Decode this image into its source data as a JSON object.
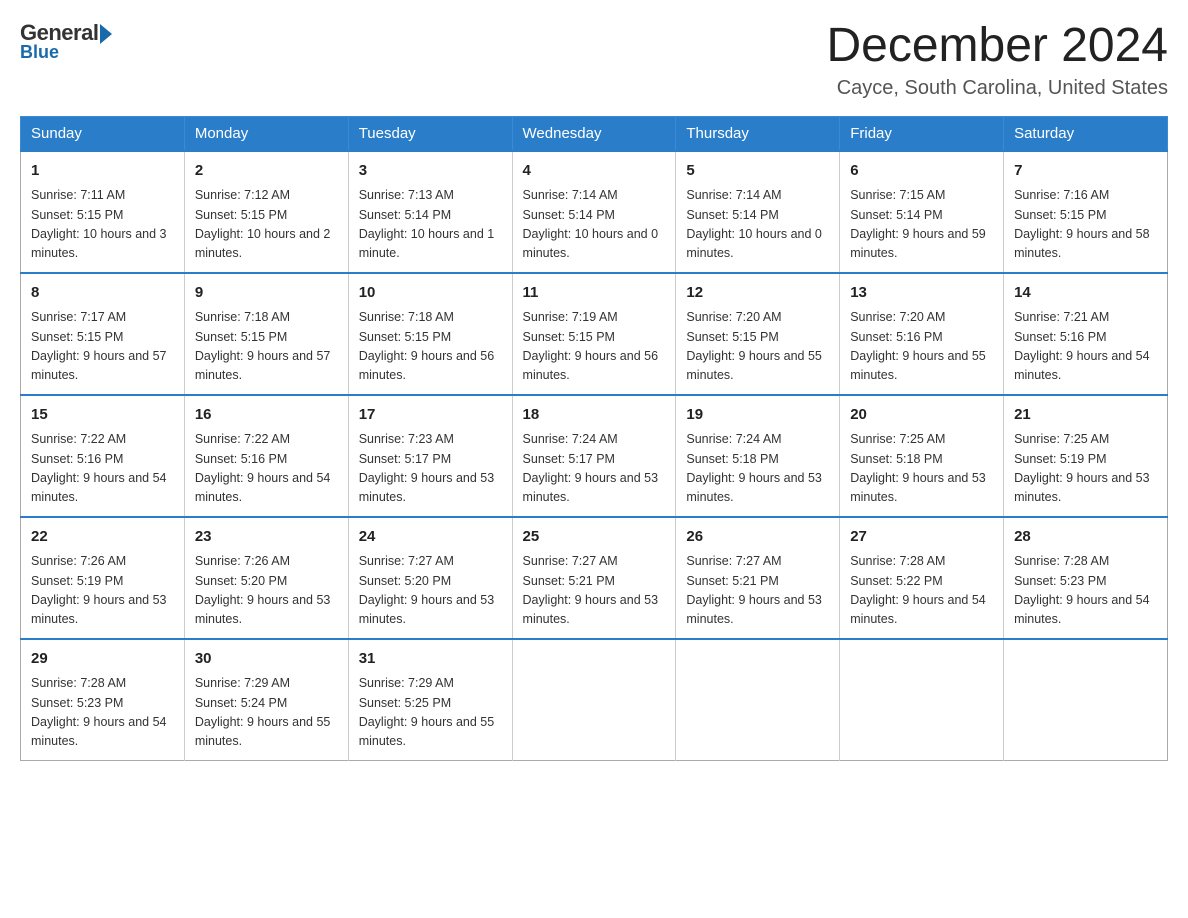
{
  "logo": {
    "general": "General",
    "blue": "Blue"
  },
  "header": {
    "month_year": "December 2024",
    "location": "Cayce, South Carolina, United States"
  },
  "days_of_week": [
    "Sunday",
    "Monday",
    "Tuesday",
    "Wednesday",
    "Thursday",
    "Friday",
    "Saturday"
  ],
  "weeks": [
    [
      {
        "day": "1",
        "sunrise": "7:11 AM",
        "sunset": "5:15 PM",
        "daylight": "10 hours and 3 minutes."
      },
      {
        "day": "2",
        "sunrise": "7:12 AM",
        "sunset": "5:15 PM",
        "daylight": "10 hours and 2 minutes."
      },
      {
        "day": "3",
        "sunrise": "7:13 AM",
        "sunset": "5:14 PM",
        "daylight": "10 hours and 1 minute."
      },
      {
        "day": "4",
        "sunrise": "7:14 AM",
        "sunset": "5:14 PM",
        "daylight": "10 hours and 0 minutes."
      },
      {
        "day": "5",
        "sunrise": "7:14 AM",
        "sunset": "5:14 PM",
        "daylight": "10 hours and 0 minutes."
      },
      {
        "day": "6",
        "sunrise": "7:15 AM",
        "sunset": "5:14 PM",
        "daylight": "9 hours and 59 minutes."
      },
      {
        "day": "7",
        "sunrise": "7:16 AM",
        "sunset": "5:15 PM",
        "daylight": "9 hours and 58 minutes."
      }
    ],
    [
      {
        "day": "8",
        "sunrise": "7:17 AM",
        "sunset": "5:15 PM",
        "daylight": "9 hours and 57 minutes."
      },
      {
        "day": "9",
        "sunrise": "7:18 AM",
        "sunset": "5:15 PM",
        "daylight": "9 hours and 57 minutes."
      },
      {
        "day": "10",
        "sunrise": "7:18 AM",
        "sunset": "5:15 PM",
        "daylight": "9 hours and 56 minutes."
      },
      {
        "day": "11",
        "sunrise": "7:19 AM",
        "sunset": "5:15 PM",
        "daylight": "9 hours and 56 minutes."
      },
      {
        "day": "12",
        "sunrise": "7:20 AM",
        "sunset": "5:15 PM",
        "daylight": "9 hours and 55 minutes."
      },
      {
        "day": "13",
        "sunrise": "7:20 AM",
        "sunset": "5:16 PM",
        "daylight": "9 hours and 55 minutes."
      },
      {
        "day": "14",
        "sunrise": "7:21 AM",
        "sunset": "5:16 PM",
        "daylight": "9 hours and 54 minutes."
      }
    ],
    [
      {
        "day": "15",
        "sunrise": "7:22 AM",
        "sunset": "5:16 PM",
        "daylight": "9 hours and 54 minutes."
      },
      {
        "day": "16",
        "sunrise": "7:22 AM",
        "sunset": "5:16 PM",
        "daylight": "9 hours and 54 minutes."
      },
      {
        "day": "17",
        "sunrise": "7:23 AM",
        "sunset": "5:17 PM",
        "daylight": "9 hours and 53 minutes."
      },
      {
        "day": "18",
        "sunrise": "7:24 AM",
        "sunset": "5:17 PM",
        "daylight": "9 hours and 53 minutes."
      },
      {
        "day": "19",
        "sunrise": "7:24 AM",
        "sunset": "5:18 PM",
        "daylight": "9 hours and 53 minutes."
      },
      {
        "day": "20",
        "sunrise": "7:25 AM",
        "sunset": "5:18 PM",
        "daylight": "9 hours and 53 minutes."
      },
      {
        "day": "21",
        "sunrise": "7:25 AM",
        "sunset": "5:19 PM",
        "daylight": "9 hours and 53 minutes."
      }
    ],
    [
      {
        "day": "22",
        "sunrise": "7:26 AM",
        "sunset": "5:19 PM",
        "daylight": "9 hours and 53 minutes."
      },
      {
        "day": "23",
        "sunrise": "7:26 AM",
        "sunset": "5:20 PM",
        "daylight": "9 hours and 53 minutes."
      },
      {
        "day": "24",
        "sunrise": "7:27 AM",
        "sunset": "5:20 PM",
        "daylight": "9 hours and 53 minutes."
      },
      {
        "day": "25",
        "sunrise": "7:27 AM",
        "sunset": "5:21 PM",
        "daylight": "9 hours and 53 minutes."
      },
      {
        "day": "26",
        "sunrise": "7:27 AM",
        "sunset": "5:21 PM",
        "daylight": "9 hours and 53 minutes."
      },
      {
        "day": "27",
        "sunrise": "7:28 AM",
        "sunset": "5:22 PM",
        "daylight": "9 hours and 54 minutes."
      },
      {
        "day": "28",
        "sunrise": "7:28 AM",
        "sunset": "5:23 PM",
        "daylight": "9 hours and 54 minutes."
      }
    ],
    [
      {
        "day": "29",
        "sunrise": "7:28 AM",
        "sunset": "5:23 PM",
        "daylight": "9 hours and 54 minutes."
      },
      {
        "day": "30",
        "sunrise": "7:29 AM",
        "sunset": "5:24 PM",
        "daylight": "9 hours and 55 minutes."
      },
      {
        "day": "31",
        "sunrise": "7:29 AM",
        "sunset": "5:25 PM",
        "daylight": "9 hours and 55 minutes."
      },
      null,
      null,
      null,
      null
    ]
  ]
}
